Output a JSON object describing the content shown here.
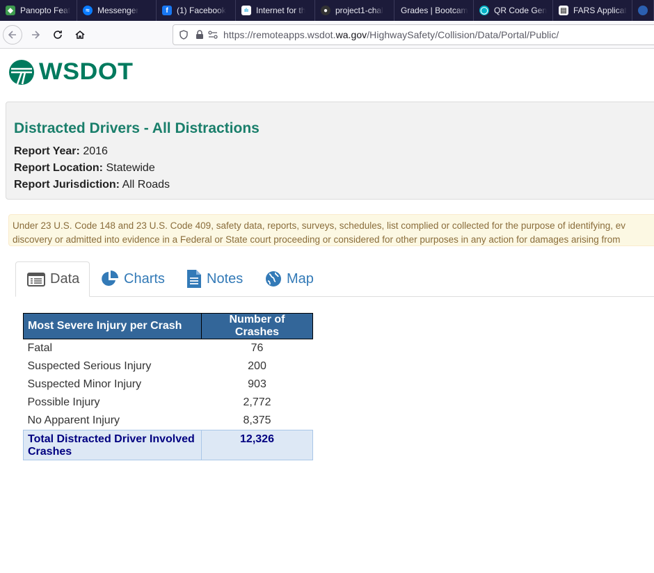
{
  "browser": {
    "tabs": [
      {
        "title": "Panopto Feat",
        "icon": "panopto-icon",
        "color": "#3e9b4f"
      },
      {
        "title": "Messenger",
        "icon": "messenger-icon",
        "color": "#0a7cff"
      },
      {
        "title": "(1) Facebook",
        "icon": "facebook-icon",
        "color": "#1877f2"
      },
      {
        "title": "Internet for th",
        "icon": "cisco-icon",
        "color": "#049fd9"
      },
      {
        "title": "project1-chal",
        "icon": "github-icon",
        "color": "#333333"
      },
      {
        "title": "Grades | Bootcam",
        "icon": "bootcamp-icon",
        "color": "#1c1b3a"
      },
      {
        "title": "QR Code Gen",
        "icon": "qr-code-icon",
        "color": "#00b3c7"
      },
      {
        "title": "FARS Applicat",
        "icon": "document-icon",
        "color": "#ffffff"
      }
    ],
    "url_prefix": "https://remoteapps.wsdot.",
    "url_domain": "wa.gov",
    "url_suffix": "/HighwaySafety/Collision/Data/Portal/Public/"
  },
  "logo": {
    "text": "WSDOT",
    "color": "#007a5e"
  },
  "report": {
    "title": "Distracted Drivers - All Distractions",
    "year_label": "Report Year:",
    "year": "2016",
    "location_label": "Report Location:",
    "location": "Statewide",
    "jurisdiction_label": "Report Jurisdiction:",
    "jurisdiction": "All Roads"
  },
  "notice": {
    "line1": "Under 23 U.S. Code 148 and 23 U.S. Code 409, safety data, reports, surveys, schedules, list complied or collected for the purpose of identifying, ev",
    "line2": "discovery or admitted into evidence in a Federal or State court proceeding or considered for other purposes in any action for damages arising from"
  },
  "tabs": [
    {
      "label": "Data",
      "icon": "table-icon",
      "active": true
    },
    {
      "label": "Charts",
      "icon": "pie-chart-icon",
      "active": false
    },
    {
      "label": "Notes",
      "icon": "document-icon",
      "active": false
    },
    {
      "label": "Map",
      "icon": "globe-icon",
      "active": false
    }
  ],
  "table": {
    "headers": [
      "Most Severe Injury per Crash",
      "Number of Crashes"
    ],
    "rows": [
      {
        "label": "Fatal",
        "value": "76"
      },
      {
        "label": "Suspected Serious Injury",
        "value": "200"
      },
      {
        "label": "Suspected Minor Injury",
        "value": "903"
      },
      {
        "label": "Possible Injury",
        "value": "2,772"
      },
      {
        "label": "No Apparent Injury",
        "value": "8,375"
      }
    ],
    "total": {
      "label": "Total Distracted Driver Involved Crashes",
      "value": "12,326"
    }
  }
}
